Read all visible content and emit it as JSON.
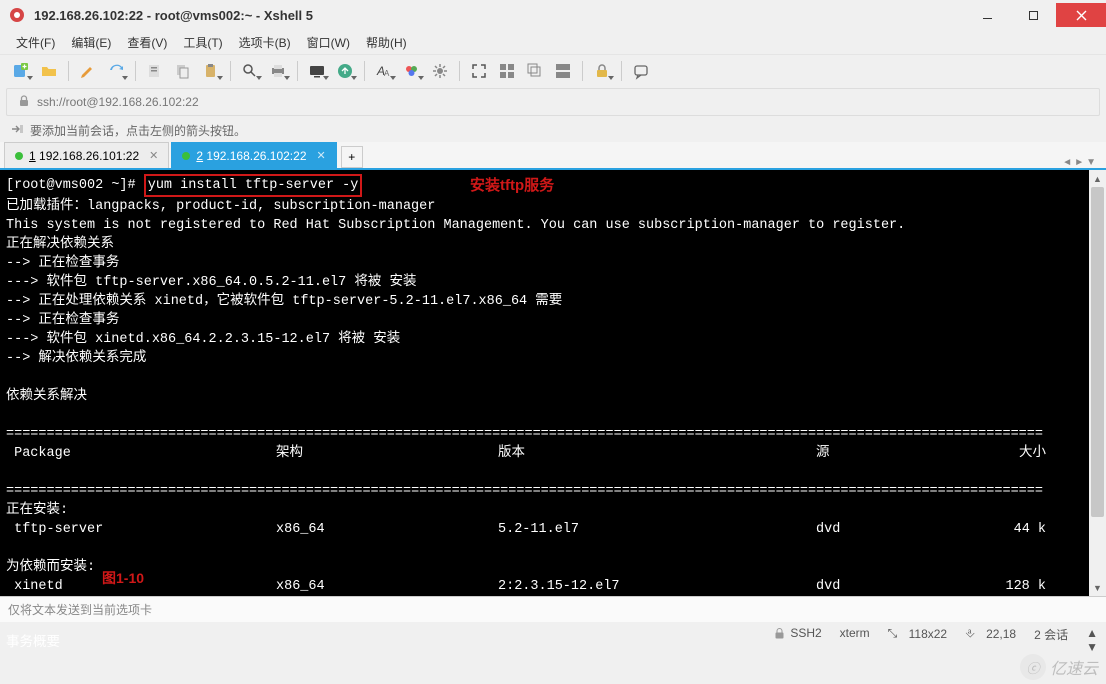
{
  "window": {
    "title_host": "192.168.26.102:22",
    "title_suffix": " root@vms002:~ - Xshell 5"
  },
  "menu": {
    "file": "文件(F)",
    "edit": "编辑(E)",
    "view": "查看(V)",
    "tools": "工具(T)",
    "tabs": "选项卡(B)",
    "window": "窗口(W)",
    "help": "帮助(H)"
  },
  "address": {
    "url": "ssh://root@192.168.26.102:22"
  },
  "reconnect_hint": "要添加当前会话，点击左侧的箭头按钮。",
  "tabs": {
    "items": [
      {
        "num": "1",
        "label": "192.168.26.101:22",
        "active": false
      },
      {
        "num": "2",
        "label": "192.168.26.102:22",
        "active": true
      }
    ],
    "add": "+"
  },
  "terminal": {
    "prompt": "[root@vms002 ~]#",
    "command": "yum install tftp-server -y",
    "annotation1": "安装tftp服务",
    "lines": [
      "已加载插件：langpacks, product-id, subscription-manager",
      "This system is not registered to Red Hat Subscription Management. You can use subscription-manager to register.",
      "正在解决依赖关系",
      "--> 正在检查事务",
      "---> 软件包 tftp-server.x86_64.0.5.2-11.el7 将被 安装",
      "--> 正在处理依赖关系 xinetd，它被软件包 tftp-server-5.2-11.el7.x86_64 需要",
      "--> 正在检查事务",
      "---> 软件包 xinetd.x86_64.2.2.3.15-12.el7 将被 安装",
      "--> 解决依赖关系完成",
      "",
      "依赖关系解决",
      ""
    ],
    "table": {
      "headers": {
        "pkg": " Package",
        "arch": "架构",
        "ver": "版本",
        "repo": "源",
        "size": "大小"
      },
      "section1": "正在安装:",
      "rows1": [
        {
          "pkg": " tftp-server",
          "arch": "x86_64",
          "ver": "5.2-11.el7",
          "repo": "dvd",
          "size": "44 k"
        }
      ],
      "section2": "为依赖而安装:",
      "rows2": [
        {
          "pkg": " xinetd",
          "arch": "x86_64",
          "ver": "2:2.3.15-12.el7",
          "repo": "dvd",
          "size": "128 k"
        }
      ]
    },
    "summary": "事务概要",
    "annotation2": "图1-10"
  },
  "input_hint": "仅将文本发送到当前选项卡",
  "status": {
    "proto": "SSH2",
    "term": "xterm",
    "size": "118x22",
    "pos": "22,18",
    "sessions_label": "2 会话",
    "resize_icon": "⤡",
    "cursor_icon": "⎀"
  },
  "watermark": "亿速云"
}
